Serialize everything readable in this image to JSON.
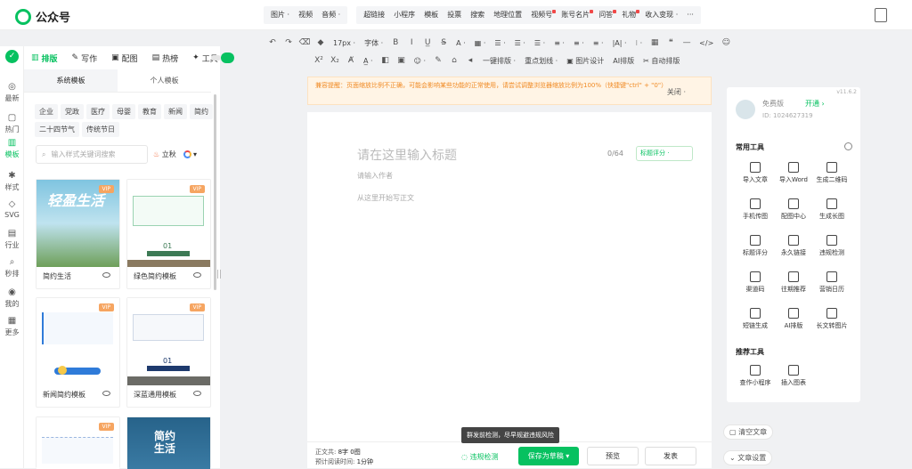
{
  "app": {
    "title": "公众号"
  },
  "menu": {
    "groups": [
      [
        {
          "label": "图片 ·",
          "dot": false
        },
        {
          "label": "视频",
          "dot": false
        },
        {
          "label": "音频 ·",
          "dot": false
        }
      ],
      [
        {
          "label": "超链接",
          "dot": false
        },
        {
          "label": "小程序",
          "dot": false
        },
        {
          "label": "模板",
          "dot": false
        },
        {
          "label": "投票",
          "dot": false
        },
        {
          "label": "搜索",
          "dot": false
        },
        {
          "label": "地理位置",
          "dot": false
        },
        {
          "label": "视频号",
          "dot": true
        },
        {
          "label": "账号名片",
          "dot": true
        },
        {
          "label": "问答",
          "dot": true
        },
        {
          "label": "礼物",
          "dot": true
        },
        {
          "label": "收入变现 ·",
          "dot": false
        },
        {
          "label": "···",
          "dot": false
        }
      ]
    ]
  },
  "toolbar": {
    "row1": [
      "↶",
      "↷",
      "⌫",
      "◆",
      "17px ·",
      "字体 ·",
      "B",
      "I",
      "U̲",
      "S̶",
      "A ·",
      "▦ ·",
      "☰ ·",
      "☰ ·",
      "☰ ·",
      "≡ ·",
      "≡ ·",
      "≡ ·",
      "|A| ·",
      "⁝ ·",
      "▦",
      "❝",
      "—",
      "</>",
      "☺"
    ],
    "row2": [
      "X²",
      "X₂",
      "Ⱥ",
      "A̲ ·",
      "◧",
      "▣",
      "☺ ·",
      "✎",
      "⌂",
      "◂",
      "一键排版 ·",
      "重点划线 ·",
      "▣ 图片设计",
      "AI排版",
      "✂ 自动排版"
    ]
  },
  "rail": [
    {
      "icon": "✓",
      "label": ""
    },
    {
      "icon": "◎",
      "label": "最新"
    },
    {
      "icon": "▢",
      "label": "热门"
    },
    {
      "icon": "▥",
      "label": "模板",
      "active": true
    },
    {
      "icon": "✱",
      "label": "样式"
    },
    {
      "icon": "◇",
      "label": "SVG"
    },
    {
      "icon": "▤",
      "label": "行业"
    },
    {
      "icon": "⌕",
      "label": "秒排"
    },
    {
      "icon": "◉",
      "label": "我的"
    },
    {
      "icon": "▦",
      "label": "更多"
    }
  ],
  "left": {
    "tabs": [
      {
        "icon": "▥",
        "label": "排版",
        "active": true
      },
      {
        "icon": "✎",
        "label": "写作"
      },
      {
        "icon": "▣",
        "label": "配图"
      },
      {
        "icon": "▤",
        "label": "热榜"
      },
      {
        "icon": "✦",
        "label": "工具"
      }
    ],
    "subtabs": [
      "系统模板",
      "个人模板"
    ],
    "categories": [
      "企业",
      "党政",
      "医疗",
      "母婴",
      "教育",
      "新闻",
      "简约",
      "二十四节气",
      "传统节日"
    ],
    "search_placeholder": "输入样式关键词搜索",
    "hot_label": "立秋",
    "cards": [
      {
        "name": "简约生活",
        "vip": "VIP",
        "art": "轻盈生活"
      },
      {
        "name": "绿色简约模板",
        "vip": "VIP",
        "art": "01"
      },
      {
        "name": "新闻简约模板",
        "vip": "VIP",
        "art": ""
      },
      {
        "name": "深蓝通用模板",
        "vip": "VIP",
        "art": "01"
      },
      {
        "name": "",
        "vip": "VIP",
        "art": ""
      },
      {
        "name": "",
        "vip": "",
        "art": "简约 生活"
      }
    ]
  },
  "notice": {
    "text": "兼容提醒：页面缩放比例不正确，可能会影响某些功能的正常使用，请尝试调整浏览器缩放比例为100%（快捷键\"ctrl\" + \"0\"）",
    "close": "关闭 ·"
  },
  "editor": {
    "title_placeholder": "请在这里输入标题",
    "title_count": "0/64",
    "score": "标题评分 ·",
    "author_placeholder": "请输入作者",
    "body_placeholder": "从这里开始写正文"
  },
  "bottom": {
    "word_count_label": "正文共:",
    "word_count_value": "8字 0图",
    "read_label": "预计阅读时间:",
    "read_value": "1分钟",
    "tooltip": "群发前检测，尽早规避违规风险",
    "violation": "违规检测",
    "save": "保存为草稿",
    "preview": "预览",
    "publish": "发表"
  },
  "right": {
    "version": "v11.6.2",
    "plan": "免费版",
    "open": "开通 ›",
    "uid": "ID: 1024627319",
    "common_title": "常用工具",
    "tools": [
      "导入文章",
      "导入Word",
      "生成二维码",
      "手机传图",
      "配图中心",
      "生成长图",
      "标题评分",
      "永久链接",
      "违规检测",
      "渠道码",
      "往期推荐",
      "营销日历",
      "短链生成",
      "AI排版",
      "长文转图片"
    ],
    "recommend_title": "推荐工具",
    "rec_tools": [
      "查作小程序",
      "插入图表"
    ],
    "clear": "清空文章",
    "settings": "文章设置"
  },
  "colors": {
    "brand": "#07c160",
    "warn": "#f08a24"
  }
}
